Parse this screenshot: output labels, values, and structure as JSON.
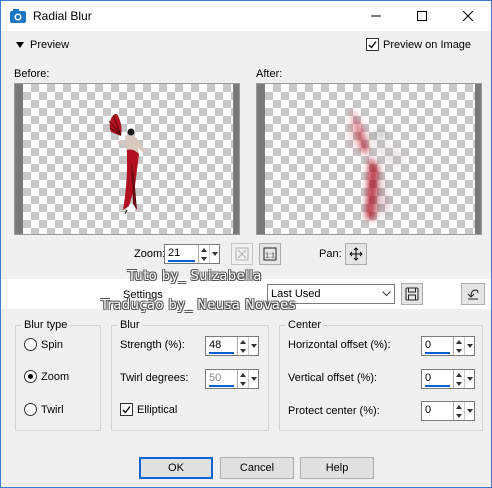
{
  "window": {
    "title": "Radial Blur"
  },
  "preview": {
    "toggle_label": "Preview",
    "preview_on_image_label": "Preview on Image",
    "preview_on_image_checked": true,
    "before_label": "Before:",
    "after_label": "After:"
  },
  "zoom": {
    "label": "Zoom:",
    "value": "21",
    "pan_label": "Pan:"
  },
  "watermark": {
    "line1": "Tuto by_ Suizabella",
    "line2": "Tradução by_ Neusa Novaes"
  },
  "settings": {
    "label": "Settings",
    "preset": "Last Used"
  },
  "blur_type": {
    "title": "Blur type",
    "options": [
      "Spin",
      "Zoom",
      "Twirl"
    ],
    "selected": "Zoom"
  },
  "blur": {
    "title": "Blur",
    "strength_label": "Strength (%):",
    "strength_value": "48",
    "twirl_label": "Twirl degrees:",
    "twirl_value": "50",
    "elliptical_label": "Elliptical",
    "elliptical_checked": true
  },
  "center": {
    "title": "Center",
    "h_offset_label": "Horizontal offset (%):",
    "h_offset_value": "0",
    "v_offset_label": "Vertical offset (%):",
    "v_offset_value": "0",
    "protect_label": "Protect center (%):",
    "protect_value": "0"
  },
  "buttons": {
    "ok": "OK",
    "cancel": "Cancel",
    "help": "Help"
  },
  "colors": {
    "accent": "#0a5fd8",
    "figure_red": "#b01020"
  }
}
